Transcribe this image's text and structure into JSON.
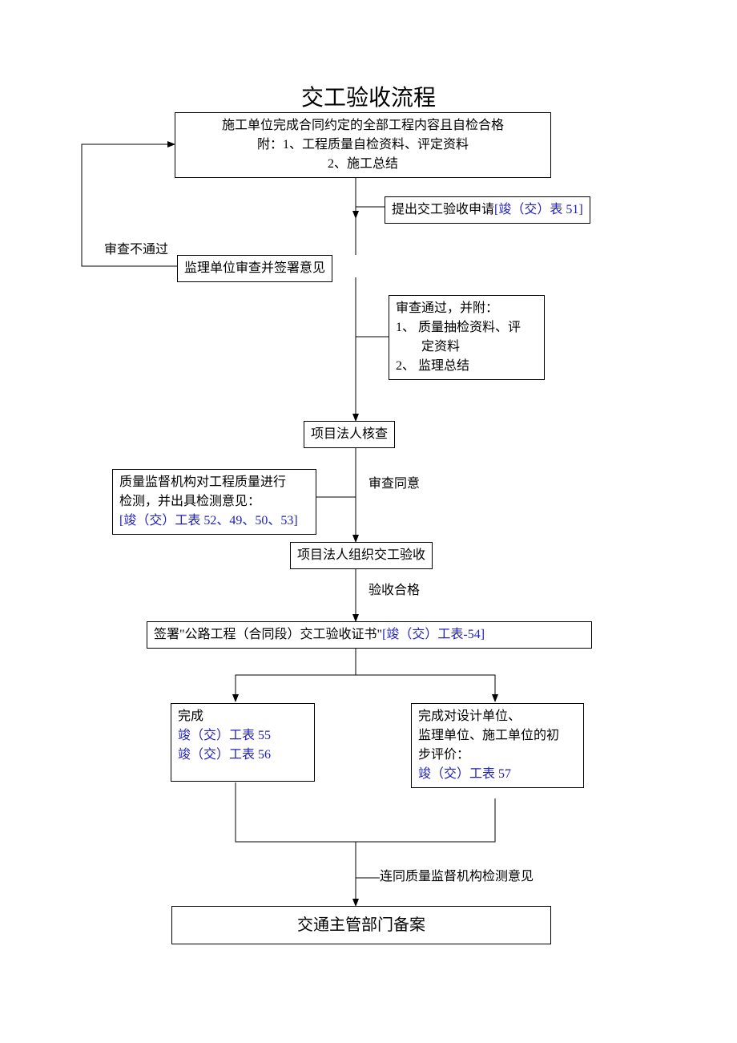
{
  "title": "交工验收流程",
  "box1": {
    "line1": "施工单位完成合同约定的全部工程内容且自检合格",
    "line2": "附：1、工程质量自检资料、评定资料",
    "line3": "2、施工总结"
  },
  "box_request": {
    "prefix": "提出交工验收申请",
    "link": "[竣（交）表 51]"
  },
  "label_reject": "审查不通过",
  "box_supervise": "监理单位审查并签署意见",
  "box_approve_attach": {
    "line1": "审查通过，并附：",
    "line2": "1、 质量抽检资料、评",
    "line3": "定资料",
    "line4": "2、 监理总结"
  },
  "box_legal_check": "项目法人核查",
  "box_quality_inspect": {
    "line1": "质量监督机构对工程质量进行",
    "line2": "检测，并出具检测意见：",
    "link": "[竣（交）工表 52、49、50、53]"
  },
  "label_approve": "审查同意",
  "box_organize": "项目法人组织交工验收",
  "label_pass": "验收合格",
  "box_sign": {
    "prefix": "签署\"公路工程（合同段）交工验收证书\"",
    "link": "[竣（交）工表-54]"
  },
  "box_left_complete": {
    "line1": "完成",
    "link1": "竣（交）工表 55",
    "link2": "竣（交）工表 56"
  },
  "box_right_complete": {
    "line1": "完成对设计单位、",
    "line2": "监理单位、施工单位的初",
    "line3": "步评价：",
    "link": "竣（交）工表 57"
  },
  "label_together": "连同质量监督机构检测意见",
  "box_final": "交通主管部门备案"
}
